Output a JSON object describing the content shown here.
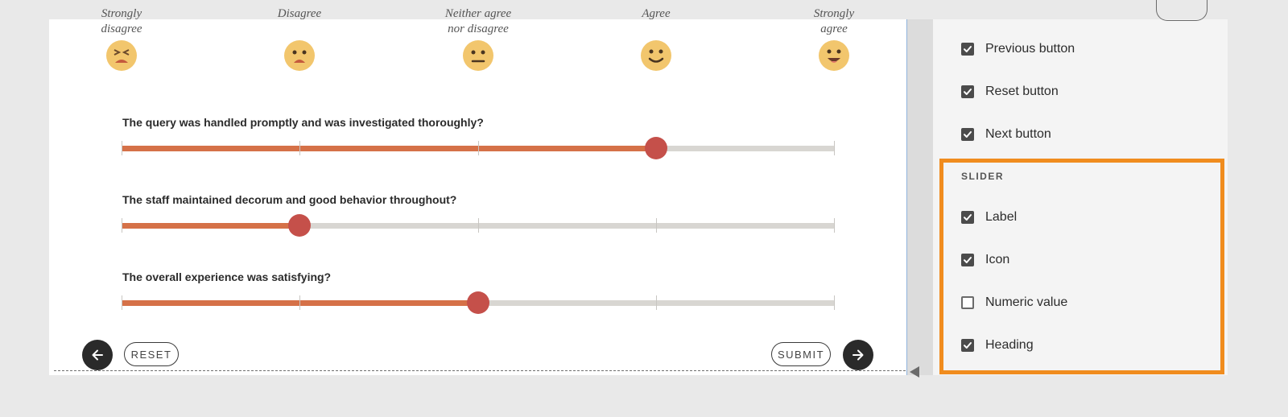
{
  "scale": {
    "labels": [
      "Strongly\ndisagree",
      "Disagree",
      "Neither agree\nnor disagree",
      "Agree",
      "Strongly\nagree"
    ],
    "icons": [
      "tired-face-icon",
      "frowning-face-icon",
      "neutral-face-icon",
      "smiling-face-icon",
      "grinning-face-icon"
    ]
  },
  "questions": [
    {
      "text": "The query was handled promptly and was investigated thoroughly?",
      "value": 0.75
    },
    {
      "text": "The staff maintained decorum and good behavior throughout?",
      "value": 0.25
    },
    {
      "text": "The overall experience was satisfying?",
      "value": 0.5
    }
  ],
  "footer": {
    "reset_label": "RESET",
    "submit_label": "SUBMIT",
    "prev_icon": "arrow-left-icon",
    "next_icon": "arrow-right-icon"
  },
  "panel": {
    "options_top": [
      {
        "label": "Previous button",
        "checked": true
      },
      {
        "label": "Reset button",
        "checked": true
      },
      {
        "label": "Next button",
        "checked": true
      }
    ],
    "slider_section": {
      "heading": "SLIDER",
      "options": [
        {
          "label": "Label",
          "checked": true
        },
        {
          "label": "Icon",
          "checked": true
        },
        {
          "label": "Numeric value",
          "checked": false
        },
        {
          "label": "Heading",
          "checked": true
        }
      ]
    }
  },
  "colors": {
    "slider_fill": "#d57148",
    "slider_thumb": "#c5504a",
    "slider_track": "#d8d6d2",
    "highlight": "#f08c1e",
    "face": "#f2c66d"
  }
}
